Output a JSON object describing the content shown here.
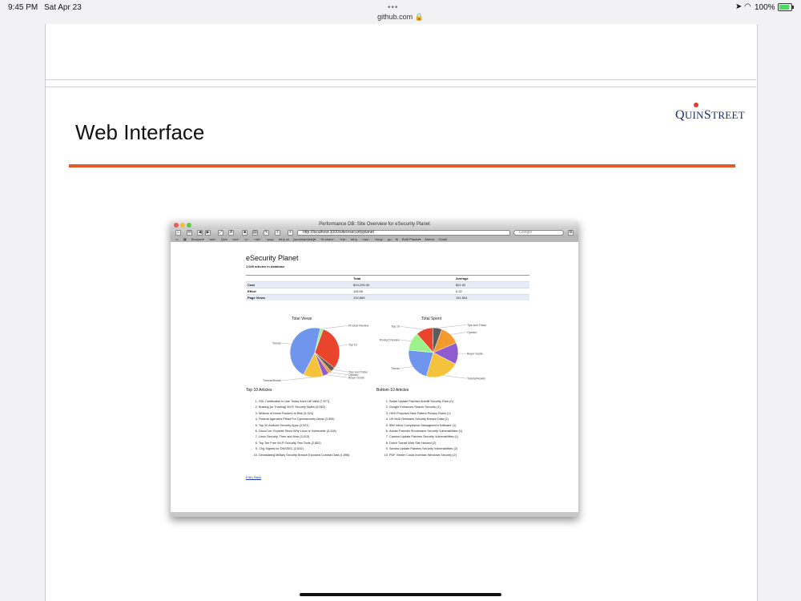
{
  "status_bar": {
    "time": "9:45 PM",
    "date": "Sat Apr 23",
    "url": "github.com",
    "battery": "100%",
    "battery_level": 1.0
  },
  "slide": {
    "title": "Web Interface",
    "logo_text": "QuinStreet",
    "accent_color": "#e4582a",
    "logo_color": "#1f2f6e"
  },
  "browser": {
    "window_title": "Performance DB: Site Overview for eSecurity Planet",
    "address": "http://localhost:3000/site/esecurityplanet",
    "search_placeholder": "Google",
    "bookmarks": [
      "Bonjour▾",
      "~sub~",
      "Quix",
      "~dot~",
      "~p~",
      "~rdlr~",
      "~pug~",
      "bit.ly sk",
      "[workmarklets]▾",
      "~fb share~",
      "~lnk~",
      "bit.ly",
      "~css~",
      "~blog~",
      "go",
      "fb",
      "Both Places▾",
      "Atomic",
      "Gmail"
    ]
  },
  "page": {
    "site_title": "eSecurity Planet",
    "article_count": "1,049 articles in database",
    "table": {
      "headers": [
        "",
        "Total",
        "Average"
      ],
      "rows": [
        {
          "label": "Cost",
          "total": "$19,225.00",
          "average": "$21.92"
        },
        {
          "label": "Effort",
          "total": "119.50",
          "average": "0.22"
        },
        {
          "label": "Page Views",
          "total": "132,869",
          "average": "151.504"
        }
      ]
    },
    "top_heading": "Top 10 Articles",
    "top_articles": [
      "SSL Certificates In Use Today Aren't All Valid (7,577)",
      "Busting (or Trusting) Wi-Fi Security Myths (6,552)",
      "Millions of Home Routers at Risk (5,324)",
      "Federal Agencies Plead For Cybersecurity Ideas (3,950)",
      "Top 20 Android Security Apps (3,921)",
      "LinuxCon: Exploits Show Why Linux is Vulnerable (3,418)",
      "Linux Security, Then and Now (3,013)",
      "Top Ten Free Wi-Fi Security Test Tools (2,852)",
      ".Org Signed for DNSSEC (2,632)",
      "Devastating Military Security Breach Exposed Combat Data (1,896)"
    ],
    "bottom_heading": "Bottom 10 Articles",
    "bottom_articles": [
      "Safari Update Patches Autofill Security Flaw (0)",
      "Google Enhances Search Security (1)",
      "HHS Proposes New Patient Privacy Rules (1)",
      "UK MoD Releases Security Breach Data (1)",
      "IBM Intros Compliance Management Software (1)",
      "Adobe Patches Shockwave Security Vulnerabilities (1)",
      "Camino Update Patches Security Vulnerabilities (1)",
      "Dutch Transit Web Site Hacked (2)",
      "Samba Update Patches Security Vulnerabilities (2)",
      "PDF Viewer Could Increase Windows Security (2)"
    ],
    "edit_label": "Edit",
    "back_label": "Back"
  },
  "chart_data": [
    {
      "type": "pie",
      "title": "Total Views",
      "categories": [
        "Top 10",
        "Tips and Tricks",
        "Opinion",
        "Buyer Guide",
        "Tutorial/Howto",
        "Trends",
        "Product Review"
      ],
      "values": [
        30,
        3,
        2,
        4,
        13,
        46,
        2
      ],
      "colors": [
        "#e8452c",
        "#5c5c5c",
        "#f29a2e",
        "#8f5ccf",
        "#f5c33b",
        "#6f95ec",
        "#9ef28b"
      ]
    },
    {
      "type": "pie",
      "title": "Total Spent",
      "categories": [
        "Opinion",
        "Buyer Guide",
        "Tutorial/Howto",
        "Trends",
        "Product Review",
        "Top 10",
        "Tips and Tricks"
      ],
      "values": [
        13,
        14,
        22,
        22,
        12,
        11,
        6
      ],
      "colors": [
        "#f29a2e",
        "#8f5ccf",
        "#f5c33b",
        "#6f95ec",
        "#9ef28b",
        "#e8452c",
        "#5c5c5c"
      ]
    }
  ]
}
